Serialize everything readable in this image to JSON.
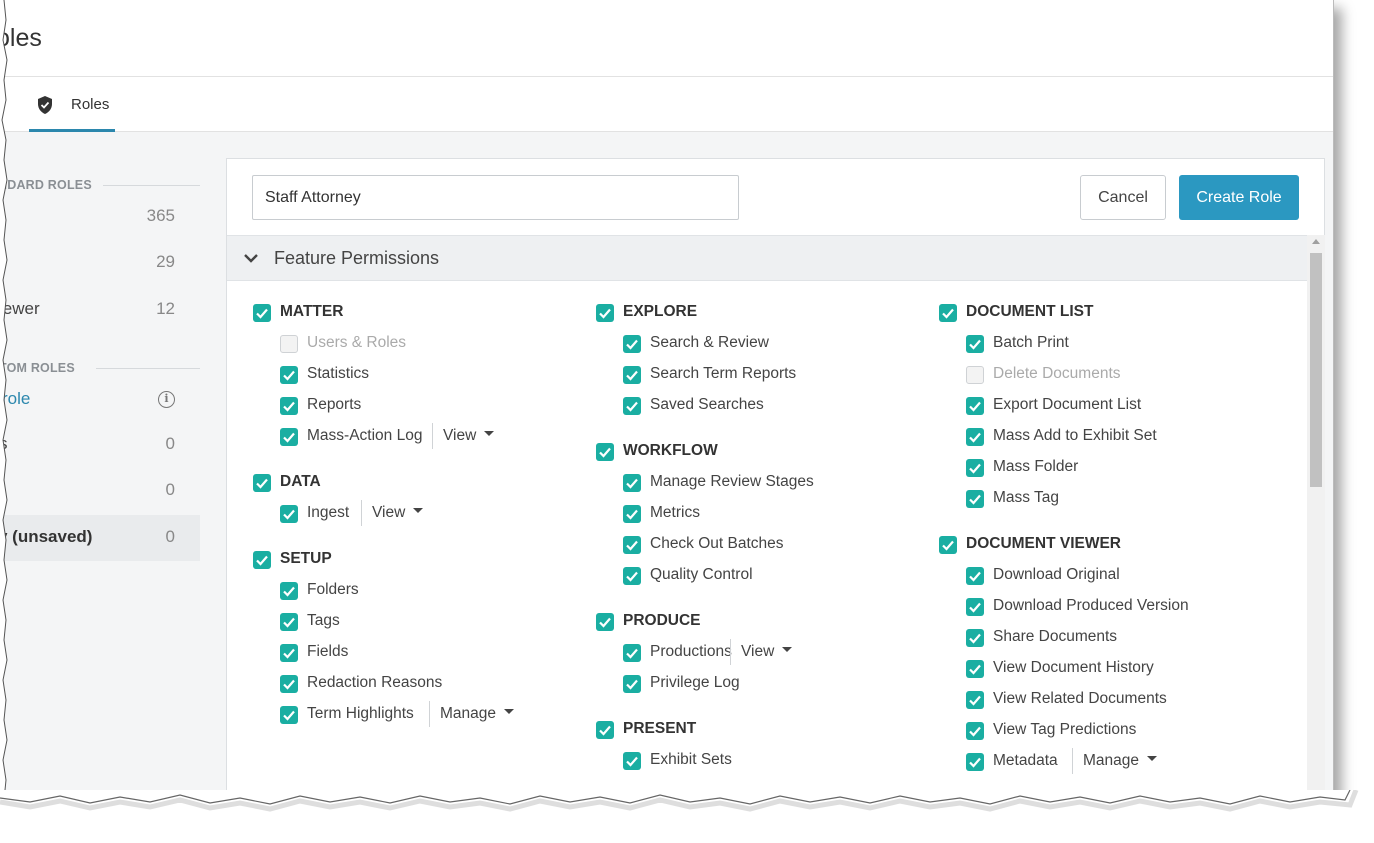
{
  "header": {
    "title": "oles"
  },
  "tabs": [
    {
      "label": "Roles",
      "icon": "shield-check-icon"
    }
  ],
  "sidebar": {
    "standard_label": "NDARD ROLES",
    "standard_roles": [
      {
        "name": "",
        "count": "365"
      },
      {
        "name": "",
        "count": "29"
      },
      {
        "name": "iewer",
        "count": "12"
      }
    ],
    "custom_label": "TOM ROLES",
    "new_role_link": "role",
    "custom_roles": [
      {
        "name": "s",
        "count": "0"
      },
      {
        "name": "",
        "count": "0"
      },
      {
        "name": "y (unsaved)",
        "count": "0"
      }
    ]
  },
  "form": {
    "role_name": "Staff Attorney",
    "cancel_label": "Cancel",
    "create_label": "Create Role"
  },
  "feature_permissions": {
    "title": "Feature Permissions",
    "accent": "#1aaea2",
    "groups": [
      {
        "name": "MATTER",
        "checked": true,
        "items": [
          {
            "label": "Users & Roles",
            "checked": false,
            "disabled": true
          },
          {
            "label": "Statistics",
            "checked": true
          },
          {
            "label": "Reports",
            "checked": true
          },
          {
            "label": "Mass-Action Log",
            "checked": true,
            "access": "View"
          }
        ]
      },
      {
        "name": "DATA",
        "checked": true,
        "items": [
          {
            "label": "Ingest",
            "checked": true,
            "access": "View"
          }
        ]
      },
      {
        "name": "SETUP",
        "checked": true,
        "items": [
          {
            "label": "Folders",
            "checked": true
          },
          {
            "label": "Tags",
            "checked": true
          },
          {
            "label": "Fields",
            "checked": true
          },
          {
            "label": "Redaction Reasons",
            "checked": true
          },
          {
            "label": "Term Highlights",
            "checked": true,
            "access": "Manage"
          }
        ]
      },
      {
        "name": "EXPLORE",
        "checked": true,
        "items": [
          {
            "label": "Search & Review",
            "checked": true
          },
          {
            "label": "Search Term Reports",
            "checked": true
          },
          {
            "label": "Saved Searches",
            "checked": true
          }
        ]
      },
      {
        "name": "WORKFLOW",
        "checked": true,
        "items": [
          {
            "label": "Manage Review Stages",
            "checked": true
          },
          {
            "label": "Metrics",
            "checked": true
          },
          {
            "label": "Check Out Batches",
            "checked": true
          },
          {
            "label": "Quality Control",
            "checked": true
          }
        ]
      },
      {
        "name": "PRODUCE",
        "checked": true,
        "items": [
          {
            "label": "Productions",
            "checked": true,
            "access": "View"
          },
          {
            "label": "Privilege Log",
            "checked": true
          }
        ]
      },
      {
        "name": "PRESENT",
        "checked": true,
        "items": [
          {
            "label": "Exhibit Sets",
            "checked": true
          }
        ]
      },
      {
        "name": "DOCUMENT LIST",
        "checked": true,
        "items": [
          {
            "label": "Batch Print",
            "checked": true
          },
          {
            "label": "Delete Documents",
            "checked": false,
            "disabled": true
          },
          {
            "label": "Export Document List",
            "checked": true
          },
          {
            "label": "Mass Add to Exhibit Set",
            "checked": true
          },
          {
            "label": "Mass Folder",
            "checked": true
          },
          {
            "label": "Mass Tag",
            "checked": true
          }
        ]
      },
      {
        "name": "DOCUMENT VIEWER",
        "checked": true,
        "items": [
          {
            "label": "Download Original",
            "checked": true
          },
          {
            "label": "Download Produced Version",
            "checked": true
          },
          {
            "label": "Share Documents",
            "checked": true
          },
          {
            "label": "View Document History",
            "checked": true
          },
          {
            "label": "View Related Documents",
            "checked": true
          },
          {
            "label": "View Tag Predictions",
            "checked": true
          },
          {
            "label": "Metadata",
            "checked": true,
            "access": "Manage"
          }
        ]
      }
    ]
  }
}
